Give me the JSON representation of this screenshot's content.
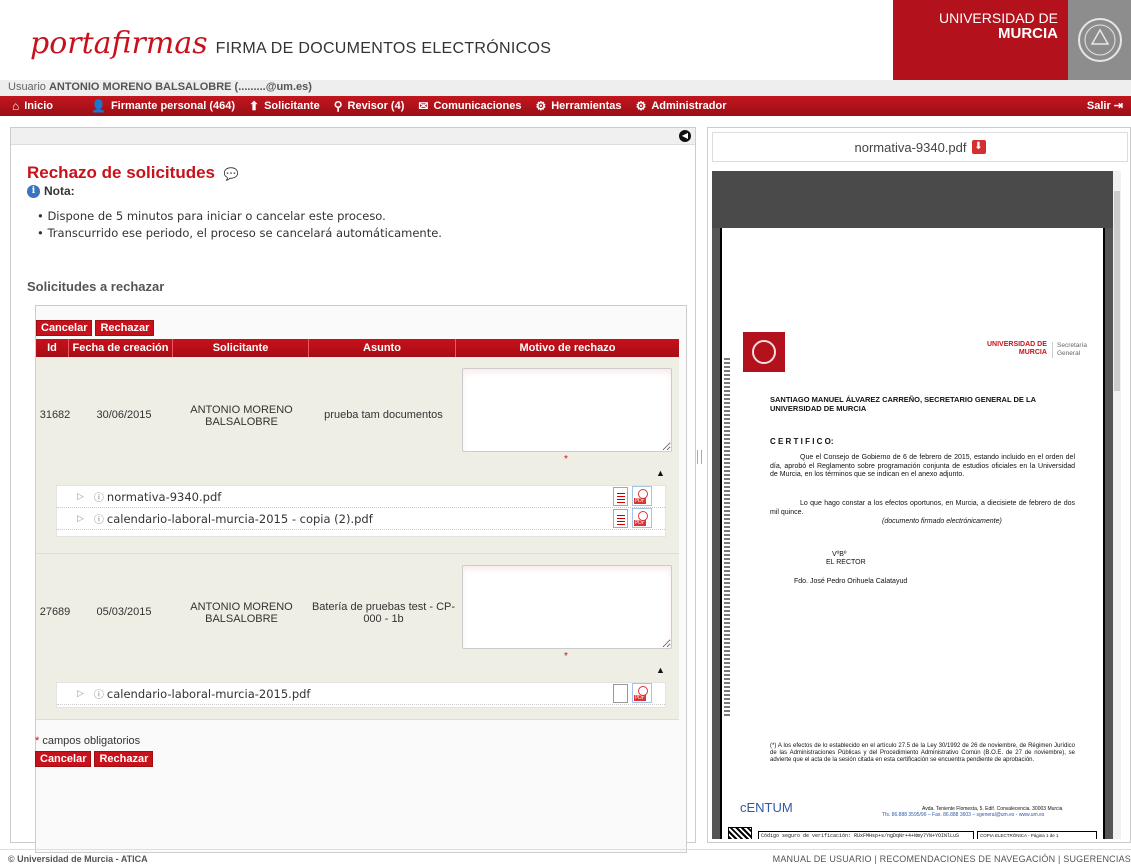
{
  "header": {
    "logo_main": "portafirmas",
    "logo_sub": "FIRMA DE DOCUMENTOS ELECTRÓNICOS",
    "univ_line1": "UNIVERSIDAD DE",
    "univ_line2": "MURCIA"
  },
  "user": {
    "prefix": "Usuario",
    "name": "ANTONIO MORENO BALSALOBRE (.........@um.es)"
  },
  "nav": {
    "items": [
      {
        "label": "Inicio",
        "icon": "home-icon"
      },
      {
        "label": "Firmante personal (464)",
        "icon": "person-icon"
      },
      {
        "label": "Solicitante",
        "icon": "arrow-up-icon"
      },
      {
        "label": "Revisor (4)",
        "icon": "magnifier-icon"
      },
      {
        "label": "Comunicaciones",
        "icon": "envelope-icon"
      },
      {
        "label": "Herramientas",
        "icon": "gear-icon"
      },
      {
        "label": "Administrador",
        "icon": "gears-icon"
      }
    ],
    "exit": "Salir"
  },
  "page": {
    "title": "Rechazo de solicitudes",
    "note_label": "Nota:",
    "notes": [
      "Dispone de 5 minutos para iniciar o cancelar este proceso.",
      "Transcurrido ese periodo, el proceso se cancelará automáticamente."
    ],
    "section": "Solicitudes a rechazar",
    "cancel": "Cancelar",
    "reject": "Rechazar",
    "required": "campos obligatorios",
    "star": "*"
  },
  "table": {
    "headers": [
      "Id",
      "Fecha de creación",
      "Solicitante",
      "Asunto",
      "Motivo de rechazo"
    ],
    "rows": [
      {
        "id": "31682",
        "date": "30/06/2015",
        "applicant": "ANTONIO MORENO BALSALOBRE",
        "subject": "prueba tam documentos",
        "reason": "",
        "files": [
          "normativa-9340.pdf",
          "calendario-laboral-murcia-2015 - copia (2).pdf"
        ]
      },
      {
        "id": "27689",
        "date": "05/03/2015",
        "applicant": "ANTONIO MORENO BALSALOBRE",
        "subject": "Batería de pruebas test - CP-000 - 1b",
        "reason": "",
        "files": [
          "calendario-laboral-murcia-2015.pdf"
        ]
      }
    ]
  },
  "viewer": {
    "filename": "normativa-9340.pdf",
    "doc_univ1": "UNIVERSIDAD DE",
    "doc_univ2": "MURCIA",
    "doc_sec1": "Secretaría",
    "doc_sec2": "General",
    "doc_heading": "SANTIAGO MANUEL ÁLVAREZ CARREÑO, SECRETARIO GENERAL DE LA UNIVERSIDAD DE MURCIA",
    "doc_cert": "C E R T I F I C O:",
    "doc_p1": "Que el Consejo de Gobierno de 6 de febrero de 2015, estando incluido en el orden del día, aprobó el Reglamento sobre programación conjunta de estudios oficiales en la Universidad de Murcia, en los términos que se indican en el anexo adjunto.",
    "doc_p2": "Lo que hago constar a los efectos oportunos, en Murcia, a diecisiete de febrero de dos mil quince.",
    "doc_p3": "(documento firmado electrónicamente)",
    "doc_vb": "VºBº",
    "doc_rector": "EL RECTOR",
    "doc_fdo": "Fdo. José Pedro Orihuela Calatayud",
    "doc_note": "(*) A los efectos de lo establecido en el artículo 27.5 de la Ley 30/1992 de 26 de noviembre, de Régimen Jurídico de las Administraciones Públicas y del Procedimiento Administrativo Común (B.O.E. de 27 de noviembre), se advierte que el acta de la sesión citada en esta certificación se encuentra pendiente de aprobación.",
    "doc_centum": "cENTUM",
    "doc_addr1": "Avda. Teniente Flomesta, 5. Edif. Convalecencia. 30003 Murcia",
    "doc_addr2": "Tfs. 86.888 3595/96 – Fax. 86.888 3603 – sgeneral@um.es - www.um.es",
    "doc_code": "Código seguro de verificación: RUxFMHsp+s/ngDqNr+4+Nmy7YN+YOINlLuS",
    "doc_copy": "COPIA ELECTRÓNICA - Página 1 de 1"
  },
  "footer": {
    "left": "© Universidad de Murcia - ATICA",
    "right": "MANUAL DE USUARIO | RECOMENDACIONES DE NAVEGACIÓN | SUGERENCIAS"
  },
  "colors": {
    "brand": "#c8111b",
    "nav": "#b3111b",
    "row_bg": "#eeeee4"
  }
}
